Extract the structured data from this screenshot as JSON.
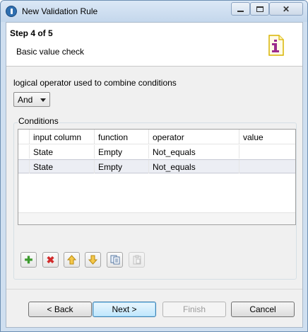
{
  "window": {
    "title": "New Validation Rule"
  },
  "header": {
    "step_title": "Step 4 of 5",
    "step_description": "Basic value check",
    "icon": "validation-rule-icon"
  },
  "operator": {
    "label": "logical operator used to combine conditions",
    "selected": "And"
  },
  "conditions": {
    "label": "Conditions",
    "columns": [
      "input column",
      "function",
      "operator",
      "value"
    ],
    "rows": [
      {
        "input_column": "State",
        "function": "Empty",
        "operator": "Not_equals",
        "value": ""
      },
      {
        "input_column": "State",
        "function": "Empty",
        "operator": "Not_equals",
        "value": ""
      }
    ]
  },
  "toolbar": {
    "add": "plus-icon",
    "delete": "delete-x-icon",
    "up": "arrow-up-icon",
    "down": "arrow-down-icon",
    "copy": "copy-icon",
    "paste": "paste-icon"
  },
  "buttons": {
    "back": "< Back",
    "next": "Next >",
    "finish": "Finish",
    "cancel": "Cancel"
  }
}
